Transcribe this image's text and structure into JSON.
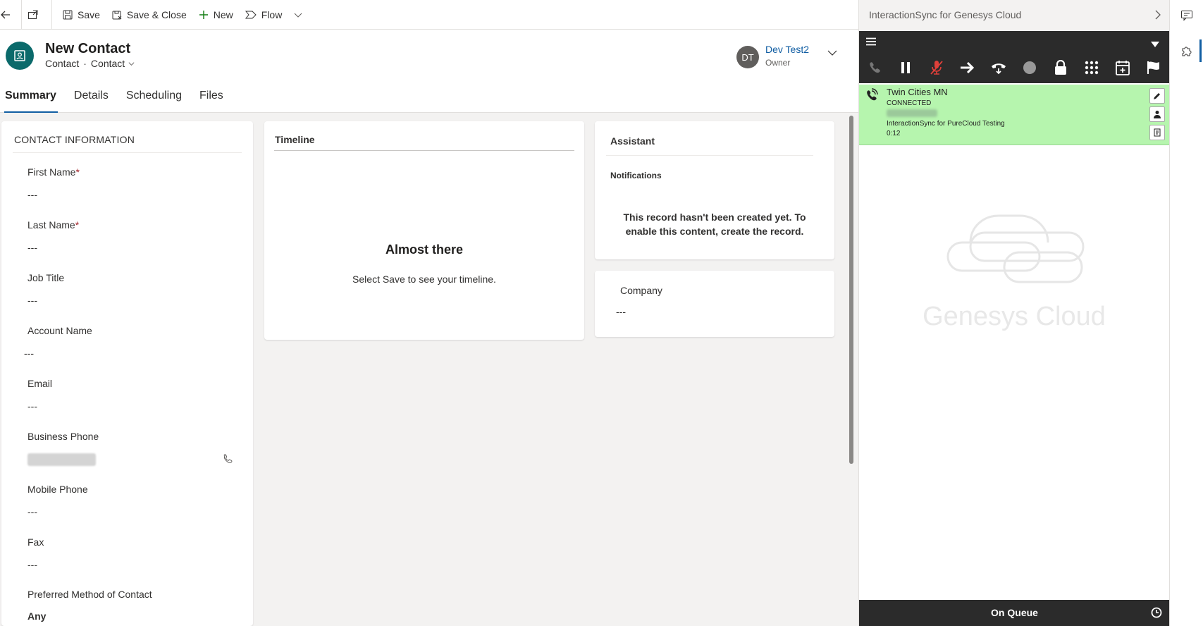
{
  "toolbar": {
    "save": "Save",
    "save_close": "Save & Close",
    "new": "New",
    "flow": "Flow"
  },
  "record": {
    "title": "New Contact",
    "entity": "Contact",
    "form": "Contact",
    "owner_initials": "DT",
    "owner_name": "Dev Test2",
    "owner_label": "Owner"
  },
  "tabs": [
    {
      "label": "Summary",
      "active": true
    },
    {
      "label": "Details"
    },
    {
      "label": "Scheduling"
    },
    {
      "label": "Files"
    }
  ],
  "contact_info": {
    "title": "CONTACT INFORMATION",
    "fields": {
      "first_name": {
        "label": "First Name",
        "required": "*",
        "value": "---"
      },
      "last_name": {
        "label": "Last Name",
        "required": "*",
        "value": "---"
      },
      "job_title": {
        "label": "Job Title",
        "value": "---"
      },
      "account_name": {
        "label": "Account Name",
        "value": "---"
      },
      "email": {
        "label": "Email",
        "value": "---"
      },
      "business_phone": {
        "label": "Business Phone"
      },
      "mobile_phone": {
        "label": "Mobile Phone",
        "value": "---"
      },
      "fax": {
        "label": "Fax",
        "value": "---"
      },
      "preferred_contact": {
        "label": "Preferred Method of Contact",
        "value": "Any"
      }
    }
  },
  "timeline": {
    "title": "Timeline",
    "empty_title": "Almost there",
    "empty_sub": "Select Save to see your timeline."
  },
  "assistant": {
    "title": "Assistant",
    "notifications": "Notifications",
    "message": "This record hasn't been created yet. To enable this content, create the record."
  },
  "company": {
    "label": "Company",
    "value": "---"
  },
  "genesys": {
    "title": "InteractionSync for Genesys Cloud",
    "call": {
      "name": "Twin Cities MN",
      "status": "CONNECTED",
      "queue": "InteractionSync for PureCloud Testing",
      "timer": "0:12"
    },
    "logo_text": "Genesys Cloud",
    "status": "On Queue",
    "colors": {
      "call_bg": "#b6f5ae",
      "dark_bar": "#2b2b2b",
      "mute_red": "#e0403a"
    }
  }
}
